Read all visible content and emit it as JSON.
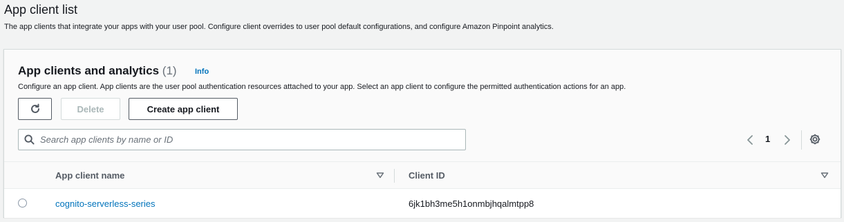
{
  "page": {
    "title": "App client list",
    "description": "The app clients that integrate your apps with your user pool. Configure client overrides to user pool default configurations, and configure Amazon Pinpoint analytics."
  },
  "panel": {
    "title": "App clients and analytics",
    "count": "(1)",
    "info_label": "Info",
    "description": "Configure an app client. App clients are the user pool authentication resources attached to your app. Select an app client to configure the permitted authentication actions for an app.",
    "refresh_icon": "refresh-icon",
    "delete_label": "Delete",
    "create_label": "Create app client",
    "search": {
      "placeholder": "Search app clients by name or ID",
      "icon": "search-icon"
    },
    "pagination": {
      "current_page": "1",
      "prev_icon": "chevron-left-icon",
      "next_icon": "chevron-right-icon"
    },
    "settings_icon": "gear-icon"
  },
  "table": {
    "columns": [
      "App client name",
      "Client ID"
    ],
    "rows": [
      {
        "name": "cognito-serverless-series",
        "client_id": "6jk1bh3me5h1onmbjhqalmtpp8"
      }
    ]
  },
  "colors": {
    "link": "#0073bb",
    "background": "#f2f3f3",
    "border": "#d5dbdb"
  }
}
